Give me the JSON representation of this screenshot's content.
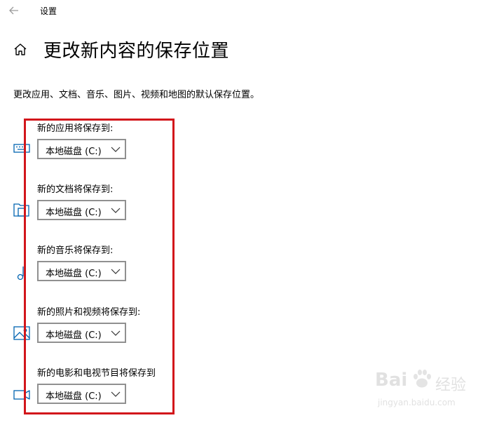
{
  "window": {
    "title": "设置"
  },
  "page": {
    "title": "更改新内容的保存位置",
    "description": "更改应用、文档、音乐、图片、视频和地图的默认保存位置。"
  },
  "settings": [
    {
      "label": "新的应用将保存到:",
      "value": "本地磁盘 (C:)",
      "icon": "app-icon"
    },
    {
      "label": "新的文档将保存到:",
      "value": "本地磁盘 (C:)",
      "icon": "document-icon"
    },
    {
      "label": "新的音乐将保存到:",
      "value": "本地磁盘 (C:)",
      "icon": "music-icon"
    },
    {
      "label": "新的照片和视频将保存到:",
      "value": "本地磁盘 (C:)",
      "icon": "picture-icon"
    },
    {
      "label": "新的电影和电视节目将保存到",
      "value": "本地磁盘 (C:)",
      "icon": "video-icon"
    }
  ],
  "watermark": {
    "brand": "Bai",
    "text": "经验",
    "url": "jingyan.baidu.com"
  },
  "colors": {
    "accent": "#0078d7",
    "annotation": "#d2161b",
    "icon": "#0063b1"
  }
}
